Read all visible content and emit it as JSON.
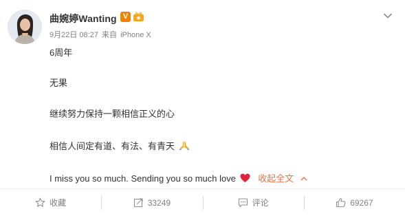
{
  "header": {
    "username": "曲婉婷Wanting",
    "verified_badge": "V",
    "date": "9月22日 08:27",
    "source_prefix": "来自",
    "source": "iPhone X",
    "icons": [
      "avatar",
      "verified-badge-icon",
      "crown-icon",
      "chevron-down-icon"
    ]
  },
  "content": {
    "lines": [
      "6周年",
      "无果",
      "继续努力保持一颗相信正义的心",
      "相信人间定有道、有法、有青天",
      "I miss you so much. Sending you so much love"
    ],
    "collapse_label": "收起全文"
  },
  "actions": {
    "favorite_label": "收藏",
    "repost_count": "33249",
    "comment_label": "评论",
    "like_count": "69267"
  },
  "colors": {
    "accent": "#eb7350",
    "badge": "#f08200",
    "muted": "#808080",
    "heart": "#e0243a"
  }
}
